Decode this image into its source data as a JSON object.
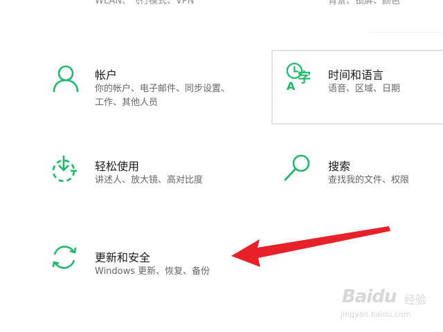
{
  "top_clipped": {
    "left_text": "WLAN、飞行模式、VPN",
    "right_text": "背景、锁屏、颜色"
  },
  "tiles": {
    "account": {
      "title": "帐户",
      "desc": "你的帐户、电子邮件、同步设置、工作、其他人员",
      "icon": "person-icon"
    },
    "time_language": {
      "title": "时间和语言",
      "desc": "语音、区域、日期",
      "icon": "time-language-icon"
    },
    "ease_of_access": {
      "title": "轻松使用",
      "desc": "讲述人、放大镜、高对比度",
      "icon": "ease-of-access-icon"
    },
    "search": {
      "title": "搜索",
      "desc": "查找我的文件、权限",
      "icon": "search-icon"
    },
    "update_security": {
      "title": "更新和安全",
      "desc": "Windows 更新、恢复、备份",
      "icon": "sync-icon"
    }
  },
  "colors": {
    "accent": "#1fb86a",
    "title_text": "#1a1a1a",
    "desc_text": "#666666",
    "arrow": "#e8202a"
  },
  "watermark": {
    "brand": "Baidu",
    "cn": "经验",
    "url": "jingyan.baidu.com"
  }
}
